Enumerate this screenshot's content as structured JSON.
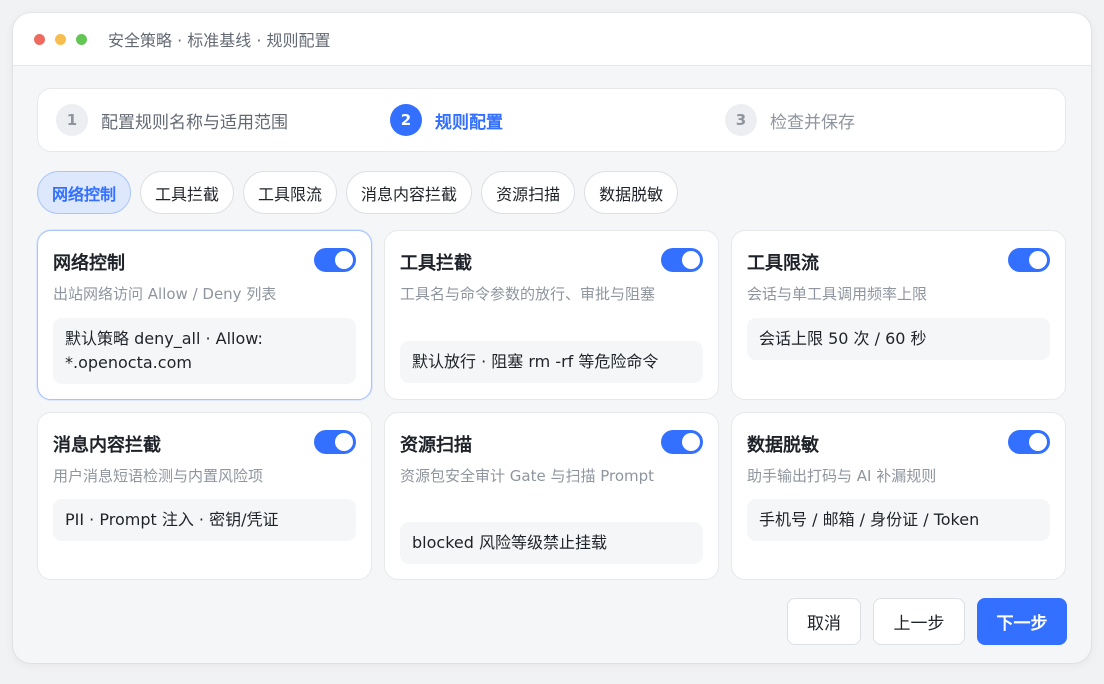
{
  "window": {
    "title": "安全策略 · 标准基线 · 规则配置"
  },
  "stepper": {
    "steps": [
      {
        "number": "1",
        "label": "配置规则名称与适用范围",
        "state": "pending"
      },
      {
        "number": "2",
        "label": "规则配置",
        "state": "active"
      },
      {
        "number": "3",
        "label": "检查并保存",
        "state": "pending"
      }
    ]
  },
  "tabs": [
    {
      "label": "网络控制",
      "active": true
    },
    {
      "label": "工具拦截",
      "active": false
    },
    {
      "label": "工具限流",
      "active": false
    },
    {
      "label": "消息内容拦截",
      "active": false
    },
    {
      "label": "资源扫描",
      "active": false
    },
    {
      "label": "数据脱敏",
      "active": false
    }
  ],
  "cards": [
    {
      "title": "网络控制",
      "description": "出站网络访问 Allow / Deny 列表",
      "value": "默认策略 deny_all · Allow: *.openocta.com",
      "enabled": true
    },
    {
      "title": "工具拦截",
      "description": "工具名与命令参数的放行、审批与阻塞",
      "value": "默认放行 · 阻塞 rm -rf 等危险命令",
      "enabled": true
    },
    {
      "title": "工具限流",
      "description": "会话与单工具调用频率上限",
      "value": "会话上限 50 次 / 60 秒",
      "enabled": true
    },
    {
      "title": "消息内容拦截",
      "description": "用户消息短语检测与内置风险项",
      "value": "PII · Prompt 注入 · 密钥/凭证",
      "enabled": true
    },
    {
      "title": "资源扫描",
      "description": "资源包安全审计 Gate 与扫描 Prompt",
      "value": "blocked 风险等级禁止挂载",
      "enabled": true
    },
    {
      "title": "数据脱敏",
      "description": "助手输出打码与 AI 补漏规则",
      "value": "手机号 / 邮箱 / 身份证 / Token",
      "enabled": true
    }
  ],
  "footer": {
    "cancel_label": "取消",
    "prev_label": "上一步",
    "next_label": "下一步"
  },
  "colors": {
    "accent": "#3370ff",
    "accent_light": "#dde8fd",
    "window_dot_red": "#ee6a5f",
    "window_dot_yellow": "#f5be4f",
    "window_dot_green": "#62c554"
  }
}
